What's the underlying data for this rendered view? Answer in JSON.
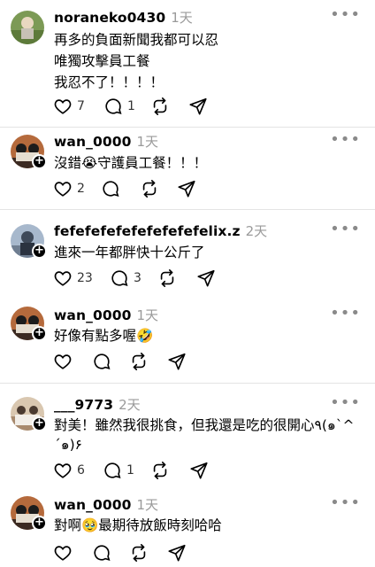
{
  "posts": [
    {
      "username": "noraneko0430",
      "time": "1天",
      "lines": [
        "再多的負面新聞我都可以忍",
        "唯獨攻擊員工餐",
        "我忍不了！！！！"
      ],
      "likes": "7",
      "replies": "1"
    },
    {
      "username": "wan_0000",
      "time": "1天",
      "lines": [
        "沒錯😭守護員工餐！！！"
      ],
      "likes": "2",
      "replies": ""
    },
    {
      "username": "fefefefefefefefefefelix.z",
      "time": "2天",
      "lines": [
        "進來一年都胖快十公斤了"
      ],
      "likes": "23",
      "replies": "3"
    },
    {
      "username": "wan_0000",
      "time": "1天",
      "lines": [
        "好像有點多喔🤣"
      ],
      "likes": "",
      "replies": ""
    },
    {
      "username": "___9773",
      "time": "2天",
      "lines": [
        "對美！雖然我很挑食，但我還是吃的很開心٩(๑`^",
        "´๑)۶"
      ],
      "likes": "6",
      "replies": "1"
    },
    {
      "username": "wan_0000",
      "time": "1天",
      "lines": [
        "對啊🥹最期待放飯時刻哈哈"
      ],
      "likes": "",
      "replies": ""
    }
  ],
  "more_glyph": "•••",
  "follow_glyph": "+",
  "icons": [
    "heart-icon",
    "comment-icon",
    "repost-icon",
    "share-icon",
    "more-icon",
    "follow-plus-icon"
  ]
}
